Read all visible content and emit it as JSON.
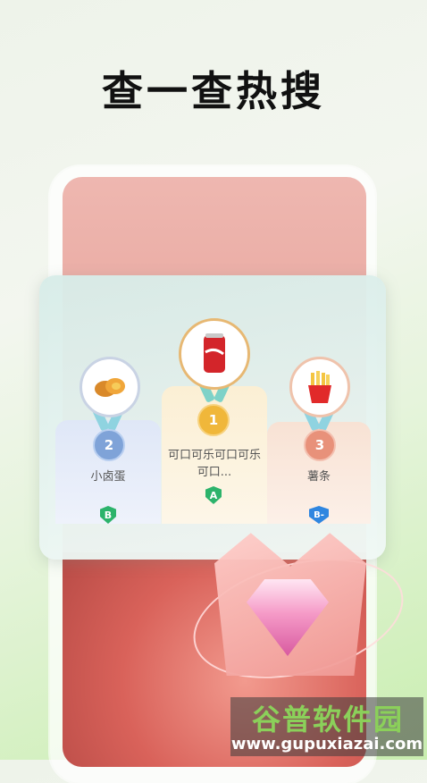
{
  "header": {
    "title": "查一查热搜"
  },
  "ranking": {
    "items": [
      {
        "rank": "2",
        "icon": "egg-icon",
        "name": "小卤蛋",
        "grade": "B"
      },
      {
        "rank": "1",
        "icon": "cola-can-icon",
        "name": "可口可乐可口可乐可口...",
        "grade": "A"
      },
      {
        "rank": "3",
        "icon": "fries-icon",
        "name": "薯条",
        "grade": "B-"
      }
    ]
  },
  "watermark": {
    "title": "谷普软件园",
    "url": "www.gupuxiazai.com"
  },
  "colors": {
    "gold": "#f0b73a",
    "silver": "#7fa3d8",
    "bronze": "#e8917a",
    "grade_green": "#2cb36b",
    "grade_blue": "#2f86e0"
  }
}
